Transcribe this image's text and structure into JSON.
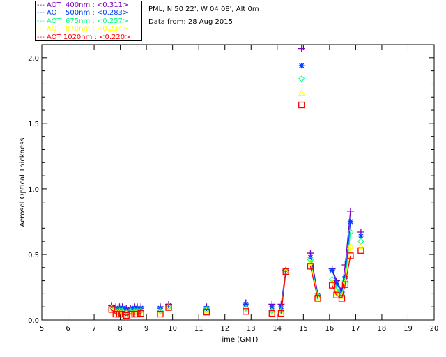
{
  "header": {
    "site": "PML, N 50 22', W 04 08', Alt 0m",
    "date": "Data from: 28 Aug 2015"
  },
  "chart_data": {
    "type": "scatter",
    "xlabel": "Time (GMT)",
    "ylabel": "Aerosol Optical Thickness",
    "xlim": [
      5,
      20
    ],
    "ylim": [
      0,
      2.1
    ],
    "xticks": [
      "5",
      "6",
      "7",
      "8",
      "9",
      "10",
      "11",
      "12",
      "13",
      "14",
      "15",
      "16",
      "17",
      "18",
      "19",
      "20"
    ],
    "yticks": [
      "0.0",
      "0.5",
      "1.0",
      "1.5",
      "2.0"
    ],
    "x": [
      7.67,
      7.83,
      7.97,
      8.08,
      8.23,
      8.39,
      8.55,
      8.65,
      8.79,
      9.53,
      9.85,
      11.3,
      12.8,
      13.8,
      14.15,
      14.33,
      14.93,
      15.27,
      15.55,
      16.1,
      16.27,
      16.47,
      16.6,
      16.8,
      17.2
    ],
    "series": [
      {
        "name": "AOT  400nm : <0.311>",
        "color": "#7f00c0",
        "marker": "plus",
        "values": [
          0.11,
          0.1,
          0.1,
          0.1,
          0.09,
          0.09,
          0.1,
          0.1,
          0.1,
          0.1,
          0.12,
          0.1,
          0.13,
          0.12,
          0.12,
          0.38,
          2.07,
          0.51,
          0.2,
          0.39,
          0.3,
          0.22,
          0.42,
          0.83,
          0.67
        ]
      },
      {
        "name": "AOT  500nm : <0.283>",
        "color": "#0040ff",
        "marker": "asterisk",
        "values": [
          0.1,
          0.09,
          0.09,
          0.09,
          0.08,
          0.08,
          0.09,
          0.09,
          0.09,
          0.09,
          0.11,
          0.09,
          0.12,
          0.1,
          0.1,
          0.38,
          1.94,
          0.48,
          0.19,
          0.38,
          0.28,
          0.21,
          0.33,
          0.75,
          0.64
        ]
      },
      {
        "name": "AOT  675nm : <0.257>",
        "color": "#00ff80",
        "marker": "diamond",
        "values": [
          0.09,
          0.07,
          0.07,
          0.07,
          0.06,
          0.07,
          0.07,
          0.07,
          0.07,
          0.07,
          0.1,
          0.08,
          0.09,
          0.07,
          0.07,
          0.37,
          1.84,
          0.46,
          0.18,
          0.31,
          0.24,
          0.19,
          0.3,
          0.67,
          0.6
        ]
      },
      {
        "name": "AOT  870nm : <0.234>",
        "color": "#ffff00",
        "marker": "triangle",
        "values": [
          0.09,
          0.06,
          0.06,
          0.06,
          0.05,
          0.06,
          0.06,
          0.06,
          0.06,
          0.06,
          0.1,
          0.07,
          0.08,
          0.06,
          0.06,
          0.37,
          1.73,
          0.44,
          0.17,
          0.29,
          0.21,
          0.18,
          0.29,
          0.56,
          0.56
        ]
      },
      {
        "name": "AOT 1020nm : <0.220>",
        "color": "#ff0000",
        "marker": "square",
        "values": [
          0.08,
          0.045,
          0.045,
          0.045,
          0.035,
          0.045,
          0.045,
          0.045,
          0.05,
          0.045,
          0.095,
          0.06,
          0.065,
          0.05,
          0.05,
          0.37,
          1.64,
          0.41,
          0.165,
          0.265,
          0.19,
          0.165,
          0.27,
          0.49,
          0.53
        ]
      }
    ],
    "grid": false,
    "legend": "top-left"
  }
}
